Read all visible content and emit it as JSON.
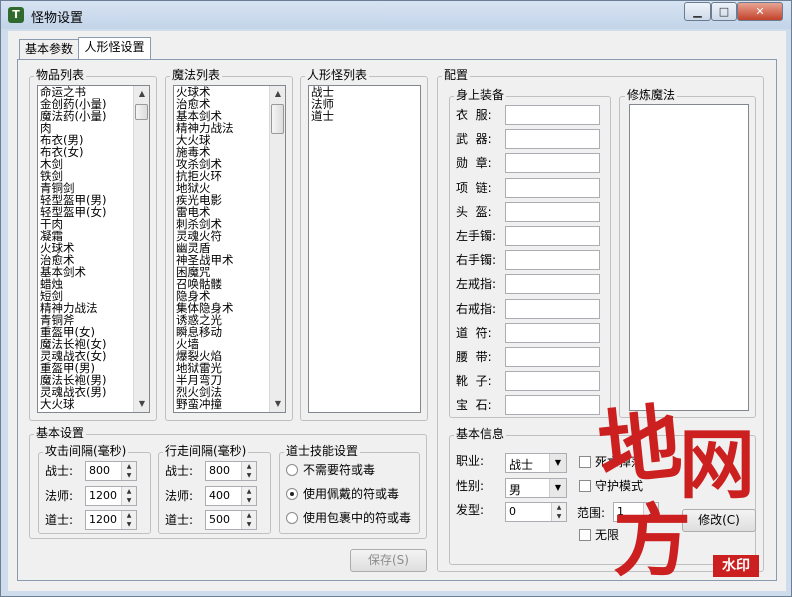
{
  "window": {
    "title": "怪物设置",
    "app_icon_glyph": "T",
    "controls": {
      "minimize": "▁",
      "maximize": "□",
      "close": "✕"
    }
  },
  "tabs": [
    {
      "label": "基本参数",
      "active": false
    },
    {
      "label": "人形怪设置",
      "active": true
    }
  ],
  "items_list": {
    "label": "物品列表",
    "items": [
      "命运之书",
      "金创药(小量)",
      "魔法药(小量)",
      "肉",
      "布衣(男)",
      "布衣(女)",
      "木剑",
      "铁剑",
      "青铜剑",
      "轻型盔甲(男)",
      "轻型盔甲(女)",
      "干肉",
      "凝霜",
      "火球术",
      "治愈术",
      "基本剑术",
      "蜡烛",
      "短剑",
      "精神力战法",
      "青铜斧",
      "重盔甲(女)",
      "魔法长袍(女)",
      "灵魂战衣(女)",
      "重盔甲(男)",
      "魔法长袍(男)",
      "灵魂战衣(男)",
      "大火球"
    ]
  },
  "magic_list": {
    "label": "魔法列表",
    "items": [
      "火球术",
      "治愈术",
      "基本剑术",
      "精神力战法",
      "大火球",
      "施毒术",
      "攻杀剑术",
      "抗拒火环",
      "地狱火",
      "疾光电影",
      "雷电术",
      "刺杀剑术",
      "灵魂火符",
      "幽灵盾",
      "神圣战甲术",
      "困魔咒",
      "召唤骷髅",
      "隐身术",
      "集体隐身术",
      "诱惑之光",
      "瞬息移动",
      "火墙",
      "爆裂火焰",
      "地狱雷光",
      "半月弯刀",
      "烈火剑法",
      "野蛮冲撞"
    ]
  },
  "humanoid_list": {
    "label": "人形怪列表",
    "items": [
      "战士",
      "法师",
      "道士"
    ]
  },
  "config": {
    "label": "配置",
    "equipment": {
      "label": "身上装备",
      "slots": [
        {
          "label": "衣  服:",
          "value": ""
        },
        {
          "label": "武  器:",
          "value": ""
        },
        {
          "label": "勋  章:",
          "value": ""
        },
        {
          "label": "项  链:",
          "value": ""
        },
        {
          "label": "头  盔:",
          "value": ""
        },
        {
          "label": "左手镯:",
          "value": ""
        },
        {
          "label": "右手镯:",
          "value": ""
        },
        {
          "label": "左戒指:",
          "value": ""
        },
        {
          "label": "右戒指:",
          "value": ""
        },
        {
          "label": "道  符:",
          "value": ""
        },
        {
          "label": "腰  带:",
          "value": ""
        },
        {
          "label": "靴  子:",
          "value": ""
        },
        {
          "label": "宝  石:",
          "value": ""
        }
      ]
    },
    "train_magic": {
      "label": "修炼魔法"
    },
    "basic_info": {
      "label": "基本信息",
      "job_label": "职业:",
      "job_value": "战士",
      "gender_label": "性别:",
      "gender_value": "男",
      "hair_label": "发型:",
      "hair_value": "0",
      "death_check_label": "死亡掉落",
      "guard_mode_label": "守护模式",
      "range_label": "范围:",
      "range_value": "1",
      "unlimited_label": "无限",
      "modify_button": "修改(C)"
    }
  },
  "basic_settings": {
    "label": "基本设置",
    "attack_interval": {
      "label": "攻击间隔(毫秒)",
      "rows": [
        {
          "label": "战士:",
          "value": "800"
        },
        {
          "label": "法师:",
          "value": "1200"
        },
        {
          "label": "道士:",
          "value": "1200"
        }
      ]
    },
    "walk_interval": {
      "label": "行走间隔(毫秒)",
      "rows": [
        {
          "label": "战士:",
          "value": "800"
        },
        {
          "label": "法师:",
          "value": "400"
        },
        {
          "label": "道士:",
          "value": "500"
        }
      ]
    },
    "taoist_skill": {
      "label": "道士技能设置",
      "options": [
        {
          "label": "不需要符或毒",
          "checked": false
        },
        {
          "label": "使用佩戴的符或毒",
          "checked": true
        },
        {
          "label": "使用包裹中的符或毒",
          "checked": false
        }
      ]
    }
  },
  "save_button": "保存(S)",
  "watermark": {
    "chars": [
      "地",
      "网",
      "方"
    ],
    "stamp": "水印",
    "color": "#cc1f1f"
  },
  "colors": {
    "title_bar": "#c3d4e9",
    "close_button": "#c3422a",
    "panel": "#f0f0f0"
  }
}
